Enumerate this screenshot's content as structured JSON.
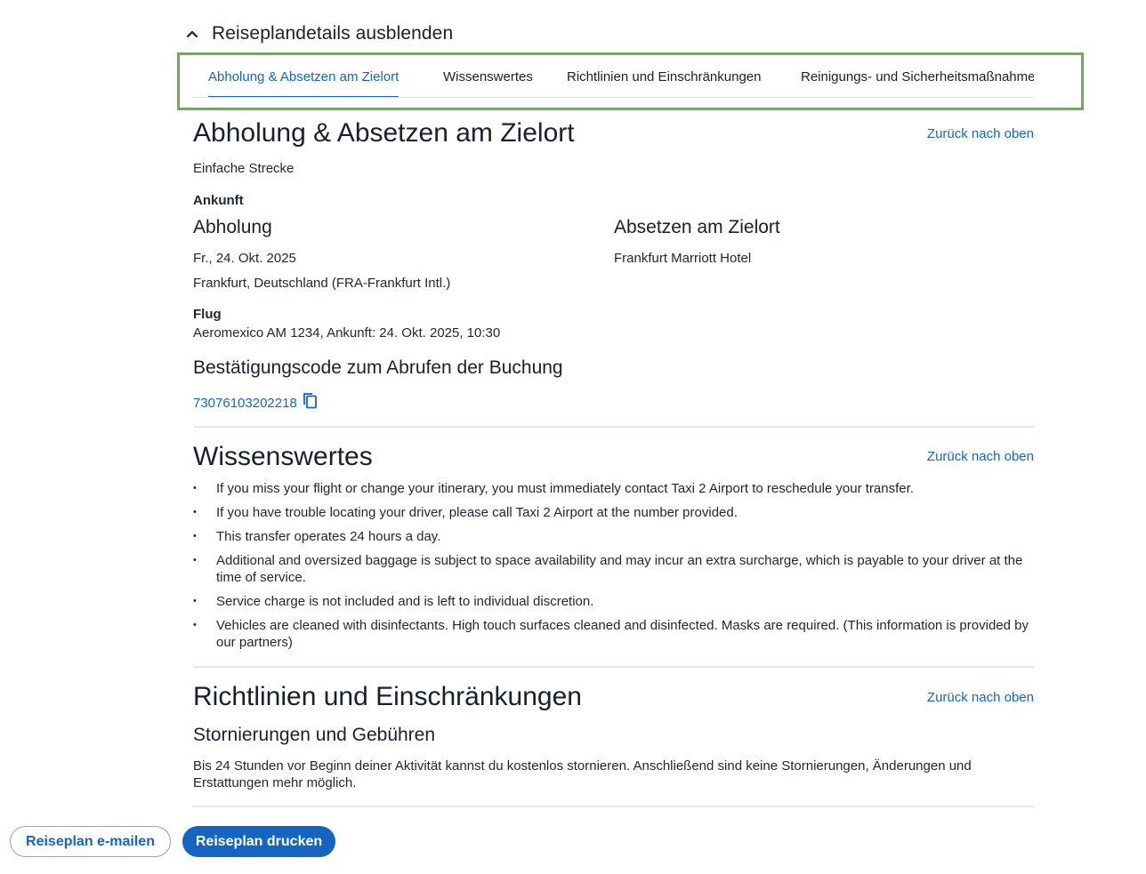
{
  "header": {
    "toggle_label": "Reiseplandetails ausblenden"
  },
  "tabs": [
    {
      "label": "Abholung & Absetzen am Zielort",
      "active": true
    },
    {
      "label": "Wissenswertes",
      "active": false
    },
    {
      "label": "Richtlinien und Einschränkungen",
      "active": false
    },
    {
      "label": "Reinigungs- und Sicherheitsmaßnahmen",
      "active": false
    }
  ],
  "back_to_top": "Zurück nach oben",
  "transfer": {
    "title": "Abholung & Absetzen am Zielort",
    "trip_type": "Einfache Strecke",
    "arrival_label": "Ankunft",
    "pickup_heading": "Abholung",
    "pickup_date": "Fr., 24. Okt. 2025",
    "pickup_location": "Frankfurt, Deutschland (FRA-Frankfurt Intl.)",
    "dropoff_heading": "Absetzen am Zielort",
    "dropoff_location": "Frankfurt Marriott Hotel",
    "flight_label": "Flug",
    "flight_info": "Aeromexico AM 1234, Ankunft: 24. Okt. 2025, 10:30",
    "confirmation_heading": "Bestätigungscode zum Abrufen der Buchung",
    "confirmation_code": "73076103202218"
  },
  "knowledge": {
    "title": "Wissenswertes",
    "items": [
      "If you miss your flight or change your itinerary, you must immediately contact Taxi 2 Airport to reschedule your transfer.",
      "If you have trouble locating your driver, please call Taxi 2 Airport at the number provided.",
      "This transfer operates 24 hours a day.",
      "Additional and oversized baggage is subject to space availability and may incur an extra surcharge, which is payable to your driver at the time of service.",
      "Service charge is not included and is left to individual discretion.",
      "Vehicles are cleaned with disinfectants. High touch surfaces cleaned and disinfected. Masks are required. (This information is provided by our partners)"
    ]
  },
  "policies": {
    "title": "Richtlinien und Einschränkungen",
    "subheading": "Stornierungen und Gebühren",
    "text": "Bis 24 Stunden vor Beginn deiner Aktivität kannst du kostenlos stornieren. Anschließend sind keine Stornierungen, Änderungen und Erstattungen mehr möglich."
  },
  "actions": {
    "email_label": "Reiseplan e-mailen",
    "print_label": "Reiseplan drucken"
  },
  "colors": {
    "accent": "#1565c0",
    "highlight": "#6ab04c",
    "text": "#1f2433"
  }
}
